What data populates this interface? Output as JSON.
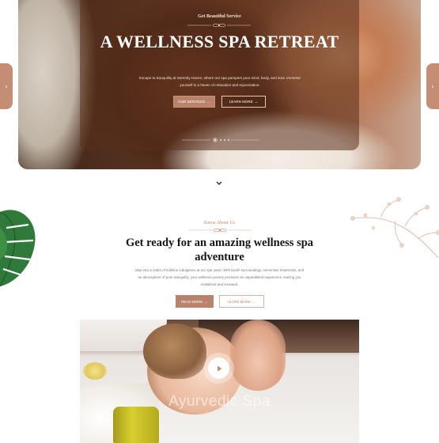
{
  "hero": {
    "kicker": "Get Beautiful Service",
    "title": "A WELLNESS SPA RETREAT",
    "subtitle": "Escape to tranquility at Serenity Haven, where our spa pampers your mind, body, and soul. Immerse yourself in a haven of relaxation and rejuvenation.",
    "services_button": "OUR SERVICES",
    "learn_more_button": "LEARN MORE",
    "arrow_icon": "→",
    "slides_total": 4,
    "active_slide": 1
  },
  "nav": {
    "prev_icon": "‹",
    "next_icon": "›"
  },
  "about": {
    "kicker": "Know About Us",
    "title": "Get ready for an amazing wellness spa adventure",
    "text": "Step into a realm of sublime indulgence at our spa oasis. With lavish surroundings, immersive treatments, and an atmosphere of pure tranquility, your wellness journey promises an unparalleled experience, leaving you revitalized and renewed.",
    "read_more_button": "READ MORE",
    "learn_more_button": "LEARN MORE",
    "arrow_icon": "→"
  },
  "video": {
    "watermark": "Ayurvedic Spa",
    "play_icon": "play-icon"
  },
  "colors": {
    "accent": "#b9826a",
    "accent_light": "#c2866a",
    "heading": "#151515"
  }
}
